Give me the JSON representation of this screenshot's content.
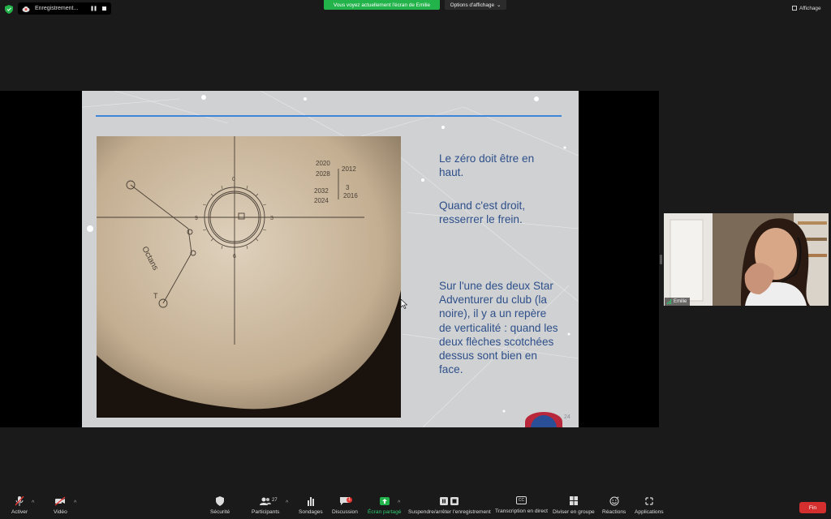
{
  "top": {
    "recording_label": "Enregistrement...",
    "pause_symbol": "❚❚",
    "sharing_banner": "Vous voyez actuellement l'écran de Emilie",
    "view_options": "Options d'affichage",
    "view_options_caret": "⌄",
    "view_button": "Affichage"
  },
  "slide": {
    "paragraph1": "Le zéro doit être en haut.",
    "paragraph2": "Quand c'est droit, resserrer le frein.",
    "paragraph3": "Sur l'une des deux Star Adventurer du club (la noire), il y a un repère de verticalité : quand les deux flèches scotchées dessus sont bien en face.",
    "page_number": "24",
    "photo": {
      "dial_0": "0",
      "dial_3": "3",
      "dial_6": "6",
      "dial_9": "9",
      "octans": "Octans",
      "t_mark": "T",
      "years": [
        "2020",
        "2028",
        "2012",
        "3",
        "2032",
        "2024",
        "2016"
      ]
    }
  },
  "participant": {
    "name": "Emilie"
  },
  "toolbar": {
    "mute": "Activer",
    "video": "Vidéo",
    "security": "Sécurité",
    "participants": "Participants",
    "participants_count": "27",
    "polls": "Sondages",
    "chat": "Discussion",
    "chat_badge": "1",
    "share": "Écran partagé",
    "recording": "Suspendre/arrêter l'enregistrement",
    "captions": "Transcription en direct",
    "cc_label": "CC",
    "breakout": "Diviser en groupe",
    "reactions": "Réactions",
    "apps": "Applications",
    "end": "Fin",
    "caret": "^"
  },
  "colors": {
    "share_green": "#23b34b",
    "end_red": "#d32f2f",
    "slide_text_blue": "#2e4f8a",
    "slide_rule_blue": "#3d86d8"
  }
}
